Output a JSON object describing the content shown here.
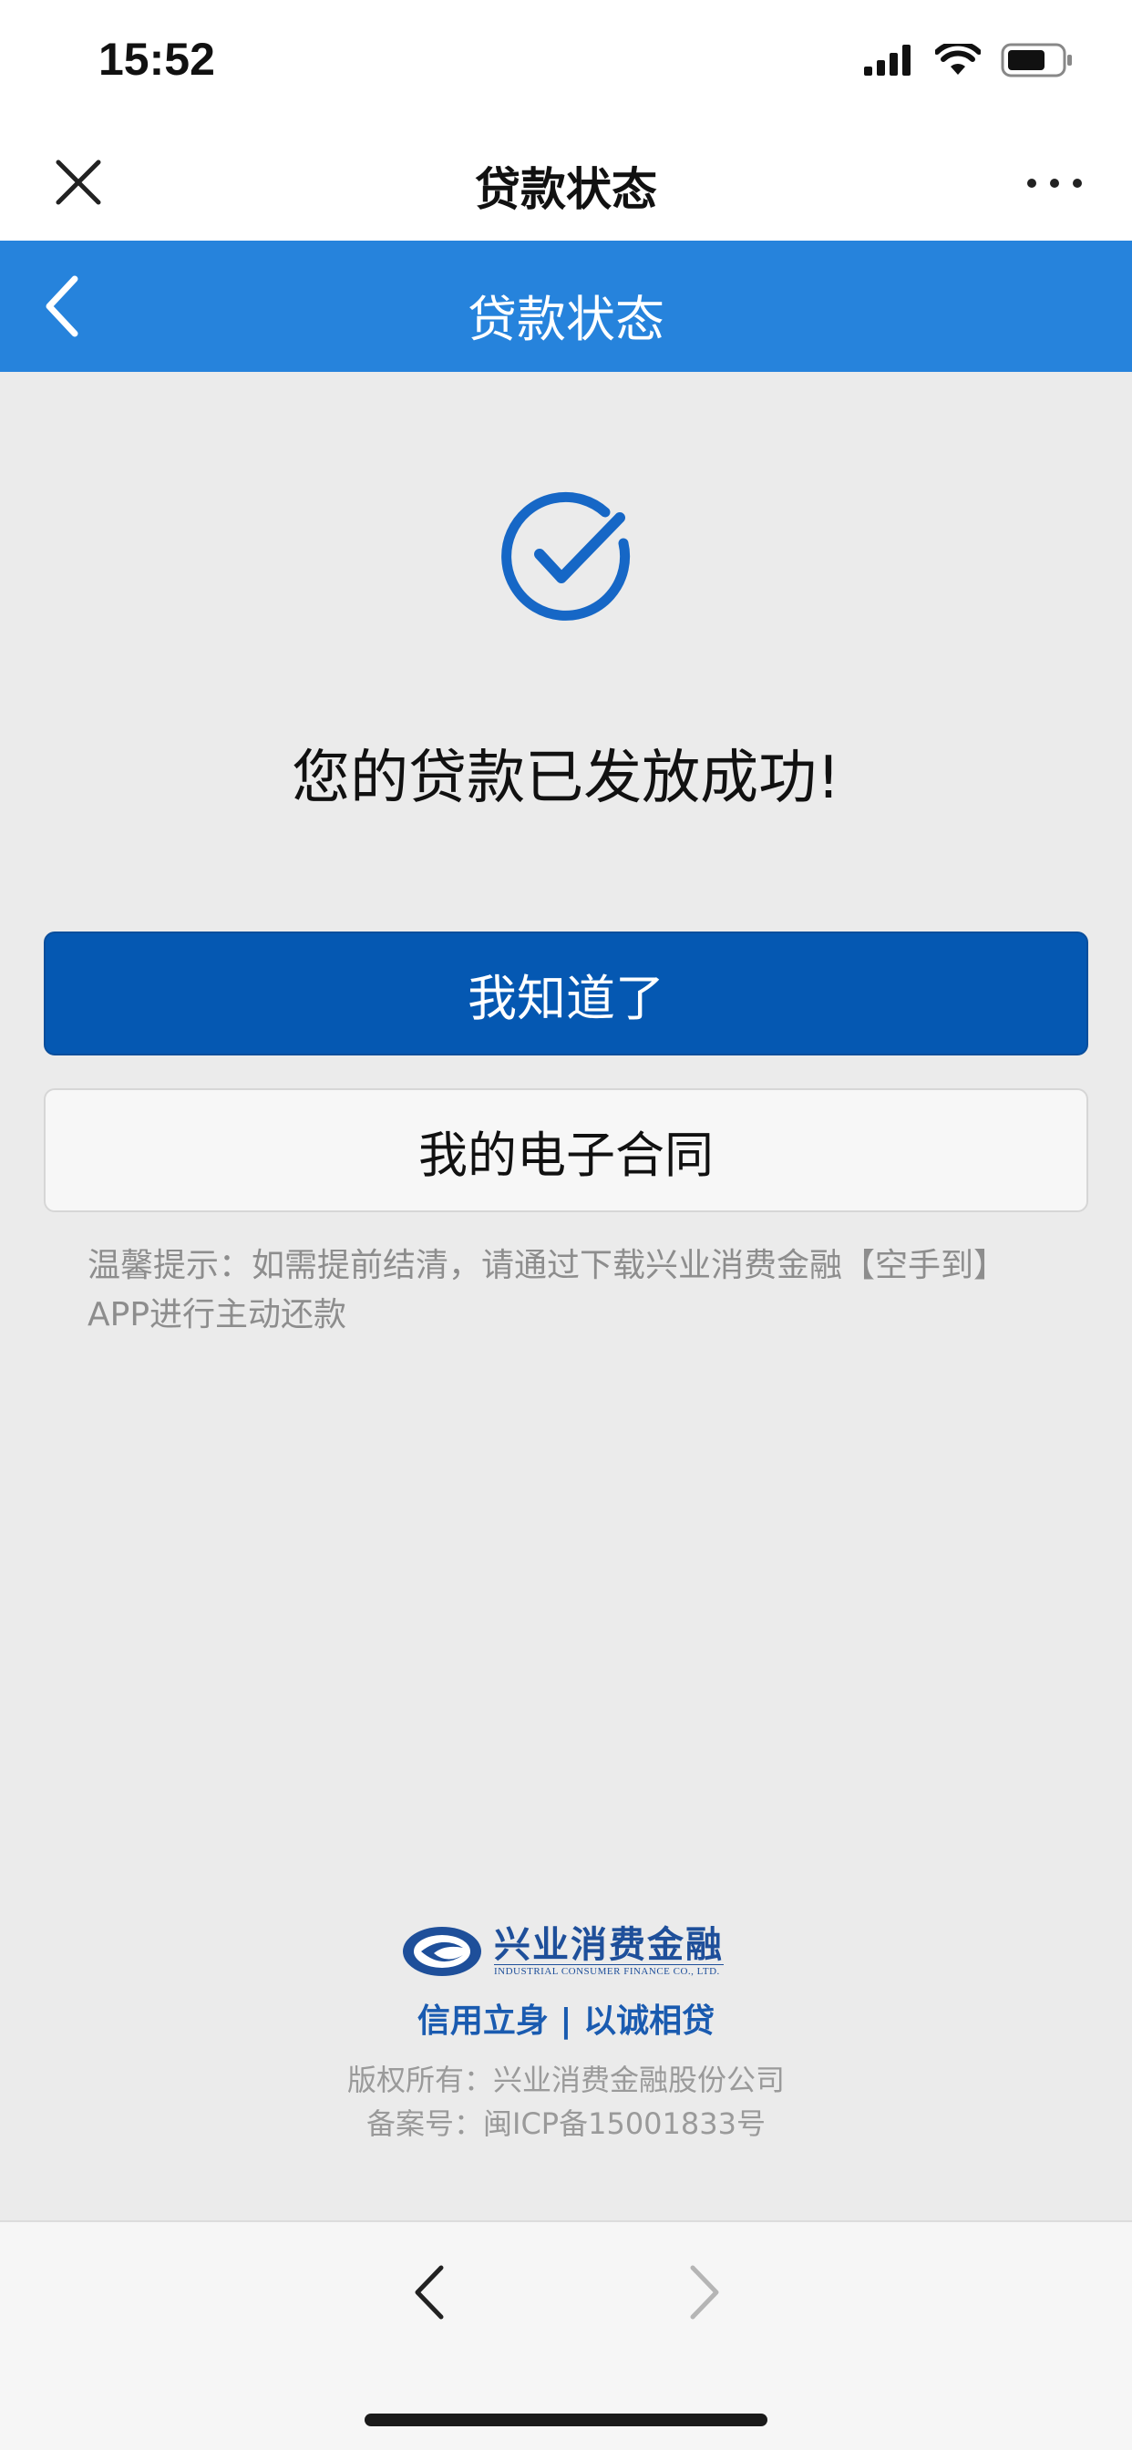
{
  "status_bar": {
    "time": "15:52"
  },
  "nav": {
    "title": "贷款状态"
  },
  "header": {
    "title": "贷款状态"
  },
  "result": {
    "message": "您的贷款已发放成功!"
  },
  "buttons": {
    "primary_label": "我知道了",
    "secondary_label": "我的电子合同"
  },
  "tip": {
    "line1": "温馨提示：如需提前结清，请通过下载兴业消费金融【空手到】",
    "line2": "APP进行主动还款"
  },
  "footer": {
    "logo_cn": "兴业消费金融",
    "logo_en": "INDUSTRIAL CONSUMER FINANCE CO., LTD.",
    "slogan": "信用立身 | 以诚相贷",
    "copyright": "版权所有：兴业消费金融股份公司",
    "icp": "备案号：闽ICP备15001833号"
  },
  "colors": {
    "header_blue": "#2683dc",
    "primary_button": "#0558b2",
    "slogan_blue": "#1a5bb0"
  },
  "icons": [
    "close-icon",
    "more-icon",
    "back-chevron-icon",
    "check-circle-icon",
    "company-logo-icon",
    "forward-chevron-icon"
  ]
}
